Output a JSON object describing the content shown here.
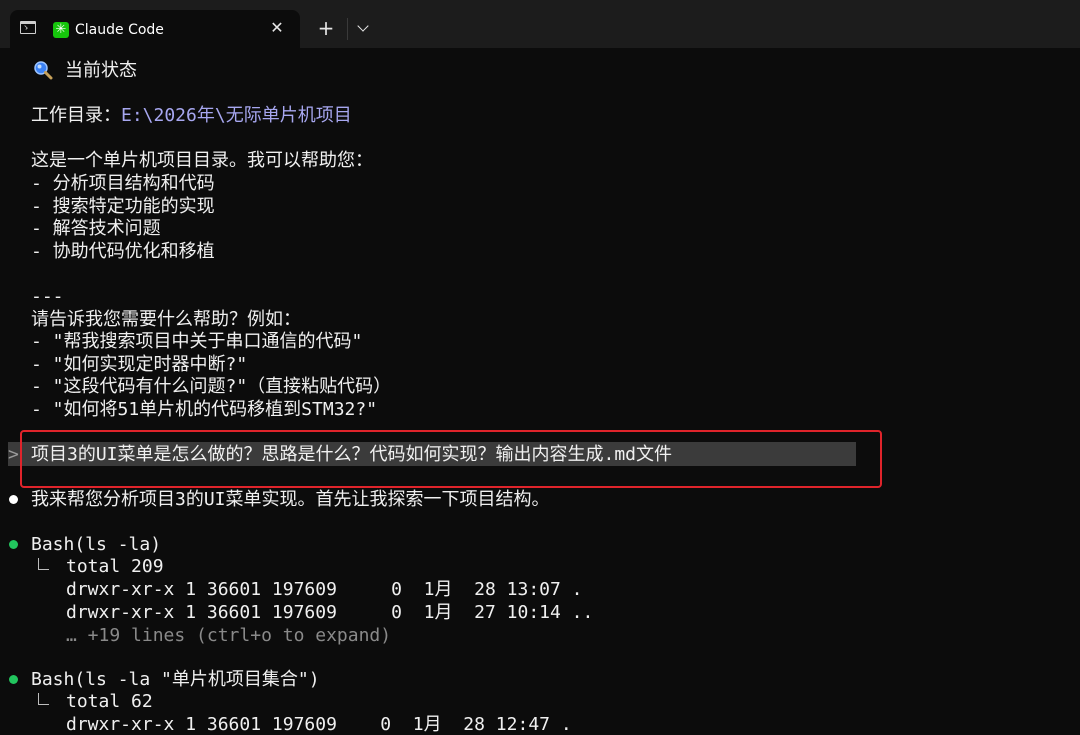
{
  "tab": {
    "title": "Claude Code",
    "app_icon": "✳",
    "close": "✕",
    "new_tab": "+",
    "terminal_icon": "terminal-icon",
    "dropdown_icon": "chevron-down-icon"
  },
  "status": {
    "heading": "当前状态",
    "workdir_label": "工作目录：",
    "workdir_path": "E:\\2026年\\无际单片机项目",
    "intro": "这是一个单片机项目目录。我可以帮助您：",
    "abilities": [
      "- 分析项目结构和代码",
      "- 搜索特定功能的实现",
      "- 解答技术问题",
      "- 协助代码优化和移植"
    ],
    "separator": "---",
    "ask": "请告诉我您需要什么帮助？例如：",
    "examples": [
      "- \"帮我搜索项目中关于串口通信的代码\"",
      "- \"如何实现定时器中断?\"",
      "- \"这段代码有什么问题?\"（直接粘贴代码）",
      "- \"如何将51单片机的代码移植到STM32?\""
    ]
  },
  "prompt": {
    "caret": ">",
    "text": "项目3的UI菜单是怎么做的？思路是什么？代码如何实现？输出内容生成.md文件"
  },
  "reply": "我来帮您分析项目3的UI菜单实现。首先让我探索一下项目结构。",
  "commands": [
    {
      "cmd": "Bash(ls -la)",
      "total": "total 209",
      "rows": [
        "drwxr-xr-x 1 36601 197609     0  1月  28 13:07 .",
        "drwxr-xr-x 1 36601 197609     0  1月  27 10:14 .."
      ],
      "more": "… +19 lines (ctrl+o to expand)"
    },
    {
      "cmd": "Bash(ls -la \"单片机项目集合\")",
      "total": "total 62",
      "rows": [
        "drwxr-xr-x 1 36601 197609    0  1月  28 12:47 ."
      ]
    }
  ],
  "colors": {
    "background": "#0c0c0c",
    "path": "#a7a7f0",
    "bullet_green": "#22c55e",
    "highlight_border": "#e0242b"
  }
}
